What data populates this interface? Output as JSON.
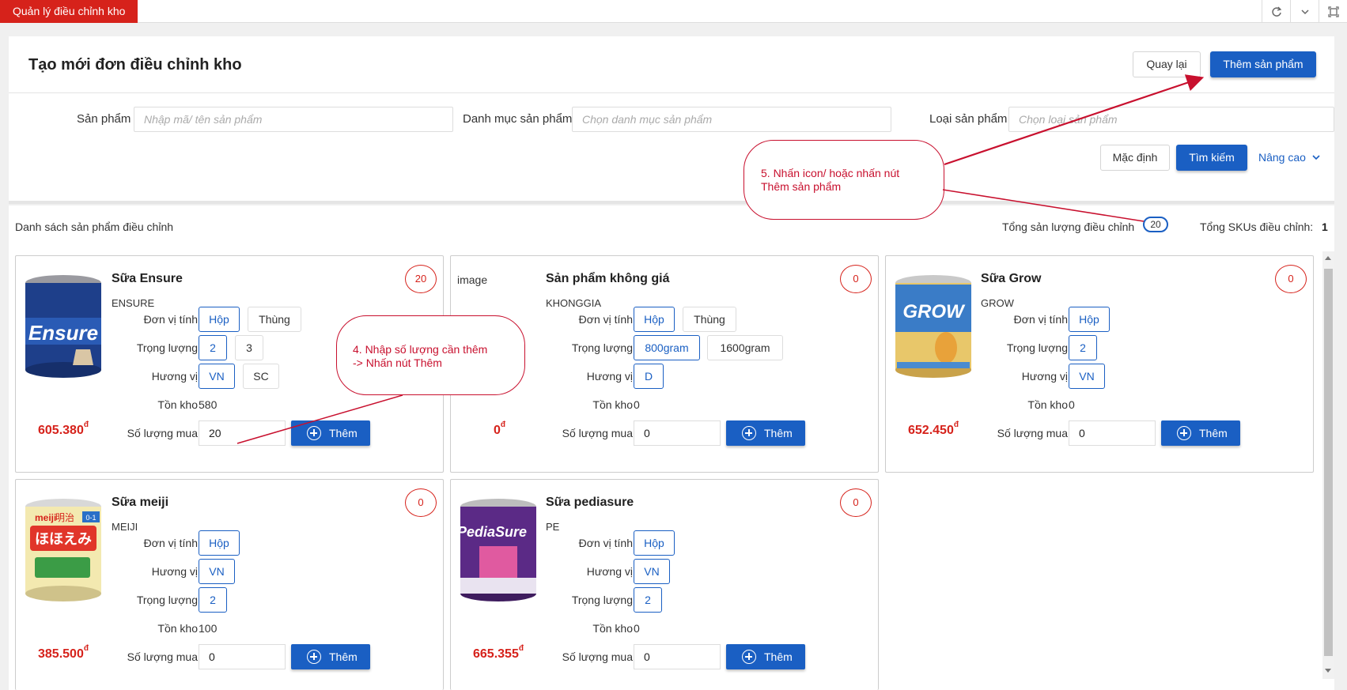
{
  "tabs": {
    "active": "Quản lý điều chỉnh kho"
  },
  "header": {
    "title": "Tạo mới đơn điều chỉnh kho",
    "back_label": "Quay lại",
    "add_product_label": "Thêm sản phẩm"
  },
  "filters": {
    "product_label": "Sản phẩm",
    "product_placeholder": "Nhập mã/ tên sản phẩm",
    "category_label": "Danh mục sản phẩm",
    "category_placeholder": "Chọn danh mục sản phẩm",
    "type_label": "Loại sản phẩm",
    "type_placeholder": "Chọn loại sản phẩm",
    "default_label": "Mặc định",
    "search_label": "Tìm kiếm",
    "advanced_label": "Nâng cao"
  },
  "list": {
    "title": "Danh sách sản phẩm điều chỉnh",
    "total_qty_label": "Tổng sản lượng điều chỉnh",
    "total_qty_value": "20",
    "total_sku_label": "Tổng SKUs điều chỉnh:",
    "total_sku_value": "1"
  },
  "labels": {
    "unit": "Đơn vị tính",
    "weight": "Trọng lượng",
    "flavor": "Hương vị",
    "stock": "Tồn kho",
    "qty": "Số lượng mua",
    "add": "Thêm"
  },
  "products": [
    {
      "name": "Sữa Ensure",
      "code": "ENSURE",
      "count": "20",
      "units": [
        "Hộp",
        "Thùng"
      ],
      "weights": [
        "2",
        "3"
      ],
      "flavors": [
        "VN",
        "SC"
      ],
      "stock": "580",
      "price": "605.380",
      "currency": "đ",
      "qty": "20"
    },
    {
      "name": "Sản phẩm không giá",
      "code": "KHONGGIA",
      "count": "0",
      "image_text": "image",
      "units": [
        "Hộp",
        "Thùng"
      ],
      "weights": [
        "800gram",
        "1600gram"
      ],
      "flavors": [
        "D"
      ],
      "stock": "0",
      "price": "0",
      "currency": "đ",
      "qty": "0"
    },
    {
      "name": "Sữa Grow",
      "code": "GROW",
      "count": "0",
      "units": [
        "Hộp"
      ],
      "weights": [
        "2"
      ],
      "flavors": [
        "VN"
      ],
      "stock": "0",
      "price": "652.450",
      "currency": "đ",
      "qty": "0"
    },
    {
      "name": "Sữa meiji",
      "code": "MEIJI",
      "count": "0",
      "units": [
        "Hộp"
      ],
      "flavors": [
        "VN"
      ],
      "weights": [
        "2"
      ],
      "stock": "100",
      "price": "385.500",
      "currency": "đ",
      "qty": "0"
    },
    {
      "name": "Sữa pediasure",
      "code": "PE",
      "count": "0",
      "units": [
        "Hộp"
      ],
      "flavors": [
        "VN"
      ],
      "weights": [
        "2"
      ],
      "stock": "0",
      "price": "665.355",
      "currency": "đ",
      "qty": "0"
    }
  ],
  "image_text": {
    "ensure": "Ensure",
    "grow": "GROW",
    "meiji_brand": "meiji",
    "meiji_jp": "明治",
    "meiji_hohoemi": "ほほえみ",
    "meiji_age": "0-1",
    "pediasure": "PediaSure"
  },
  "annotations": {
    "step4_line1": "4. Nhập số lượng cần thêm",
    "step4_line2": "-> Nhấn nút Thêm",
    "step5_line1": "5. Nhấn icon/ hoặc nhấn nút",
    "step5_line2": "Thêm sản phẩm"
  },
  "colors": {
    "brand_red": "#d6221b",
    "primary_blue": "#1a5fc3",
    "annotation_red": "#c8102e"
  }
}
